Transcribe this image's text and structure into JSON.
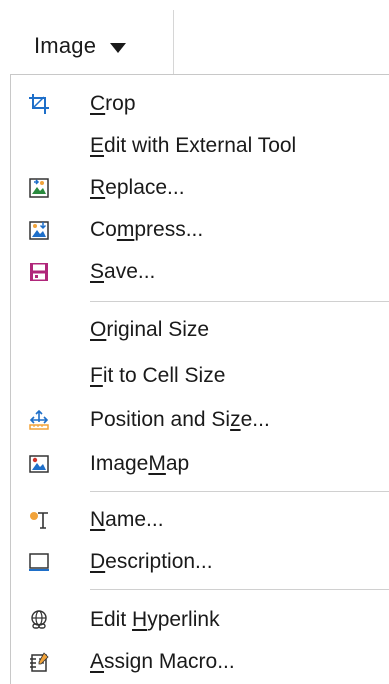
{
  "menu_button": {
    "label": "Image"
  },
  "items": [
    {
      "pre": "",
      "ul": "C",
      "post": "rop",
      "icon": "crop-icon"
    },
    {
      "pre": "",
      "ul": "E",
      "post": "dit with External Tool",
      "icon": ""
    },
    {
      "pre": "",
      "ul": "R",
      "post": "eplace...",
      "icon": "replace-image-icon"
    },
    {
      "pre": "Co",
      "ul": "m",
      "post": "press...",
      "icon": "compress-image-icon"
    },
    {
      "pre": "",
      "ul": "S",
      "post": "ave...",
      "icon": "save-icon"
    },
    {
      "pre": "",
      "ul": "O",
      "post": "riginal Size",
      "icon": ""
    },
    {
      "pre": "",
      "ul": "F",
      "post": "it to Cell Size",
      "icon": ""
    },
    {
      "pre": "Position and Si",
      "ul": "z",
      "post": "e...",
      "icon": "position-size-icon"
    },
    {
      "pre": "Image",
      "ul": "M",
      "post": "ap",
      "icon": "imagemap-icon"
    },
    {
      "pre": "",
      "ul": "N",
      "post": "ame...",
      "icon": "name-icon"
    },
    {
      "pre": "",
      "ul": "D",
      "post": "escription...",
      "icon": "description-icon"
    },
    {
      "pre": "Edit ",
      "ul": "H",
      "post": "yperlink",
      "icon": "hyperlink-icon"
    },
    {
      "pre": "",
      "ul": "A",
      "post": "ssign Macro...",
      "icon": "assign-macro-icon"
    }
  ],
  "colors": {
    "accent_blue": "#1e6fc9",
    "magenta": "#b0267a",
    "orange": "#f2a33a"
  }
}
